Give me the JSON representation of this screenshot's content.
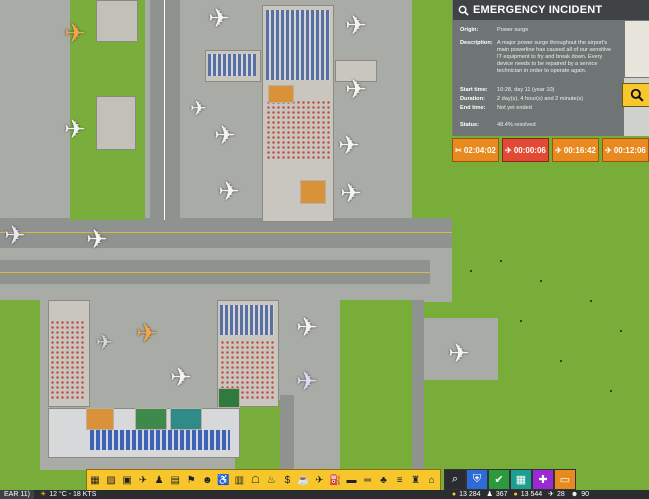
{
  "incident": {
    "title": "EMERGENCY INCIDENT",
    "origin_label": "Origin:",
    "origin_value": "Power surge",
    "description_label": "Description:",
    "description_value": "A major power surge throughout the airport's main powerline has caused all of our sensitive IT equipment to fry and break down. Every device needs to be repaired by a service technician in order to operate again.",
    "start_label": "Start time:",
    "start_value": "10:28, day 11 (year 10)",
    "duration_label": "Duration:",
    "duration_value": "2 day(s), 4 hour(s) and 2 minute(s)",
    "end_label": "End time:",
    "end_value": "Not yet ended",
    "status_label": "Status:",
    "status_value": "48.4% resolved",
    "status_fraction": 0.484
  },
  "timers": [
    {
      "icon": "wrench-icon",
      "value": "02:04:02",
      "color": "#e88a1f"
    },
    {
      "icon": "plane-icon",
      "value": "00:00:06",
      "color": "#e34a35"
    },
    {
      "icon": "plane-icon",
      "value": "00:16:42",
      "color": "#e88a1f"
    },
    {
      "icon": "plane-icon",
      "value": "00:12:06",
      "color": "#e88a1f"
    }
  ],
  "toolbar": {
    "icons": [
      "terrain-icon",
      "hazard-icon",
      "bus-icon",
      "airport-icon",
      "person-icon",
      "building-icon",
      "flag-icon",
      "people-icon",
      "toilet-icon",
      "luggage-icon",
      "shop-icon",
      "seat-icon",
      "money-icon",
      "food-icon",
      "jet-icon",
      "fuel-icon",
      "car-icon",
      "road-icon",
      "tree-icon",
      "stairs-icon",
      "hat-icon",
      "tent-icon"
    ]
  },
  "tools2": [
    {
      "icon": "search-icon",
      "color": "#2a2d2f"
    },
    {
      "icon": "shield-icon",
      "color": "#2f6bd6"
    },
    {
      "icon": "badge-icon",
      "color": "#2a9a3d"
    },
    {
      "icon": "grid-icon",
      "color": "#1c9e90"
    },
    {
      "icon": "puzzle-icon",
      "color": "#9a2ad6"
    },
    {
      "icon": "train-icon",
      "color": "#e88a1f"
    }
  ],
  "status": {
    "date": "EAR 11)",
    "weather": "12 °C - 18 KTS",
    "money1": "13 284",
    "count1": "367",
    "money2": "13 544",
    "count2": "28",
    "count3": "90"
  }
}
